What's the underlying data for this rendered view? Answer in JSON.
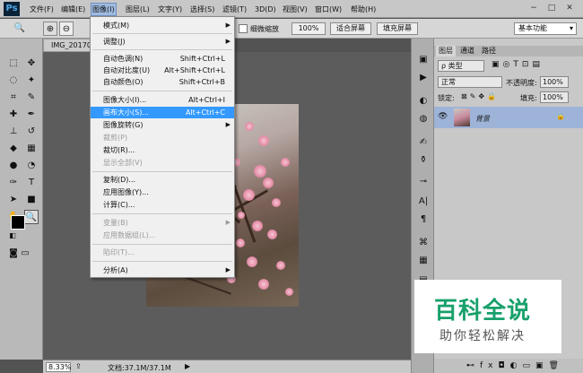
{
  "app": {
    "logo": "Ps"
  },
  "menubar": {
    "items": [
      "文件(F)",
      "编辑(E)",
      "图像(I)",
      "图层(L)",
      "文字(Y)",
      "选择(S)",
      "滤镜(T)",
      "3D(D)",
      "视图(V)",
      "窗口(W)",
      "帮助(H)"
    ],
    "active": "图像(I)"
  },
  "window_controls": {
    "minimize": "−",
    "maximize": "□",
    "close": "✕"
  },
  "options": {
    "fit_label": "细微缩放",
    "zoom_btn": "100%",
    "fit_screen": "适合屏幕",
    "fill_screen": "填充屏幕",
    "workspace": "基本功能"
  },
  "document": {
    "tab": "IMG_20170..."
  },
  "image_menu": {
    "mode": "模式(M)",
    "adjust": "调整(J)",
    "auto_tone": "自动色调(N)",
    "auto_tone_sc": "Shift+Ctrl+L",
    "auto_contrast": "自动对比度(U)",
    "auto_contrast_sc": "Alt+Shift+Ctrl+L",
    "auto_color": "自动颜色(O)",
    "auto_color_sc": "Shift+Ctrl+B",
    "image_size": "图像大小(I)...",
    "image_size_sc": "Alt+Ctrl+I",
    "canvas_size": "画布大小(S)...",
    "canvas_size_sc": "Alt+Ctrl+C",
    "rotate": "图像旋转(G)",
    "crop": "裁剪(P)",
    "trim": "裁切(R)...",
    "reveal_all": "显示全部(V)",
    "duplicate": "复制(D)...",
    "apply_image": "应用图像(Y)...",
    "calculations": "计算(C)...",
    "variables": "变量(B)",
    "apply_dataset": "应用数据组(L)...",
    "trap": "陷印(T)...",
    "analysis": "分析(A)"
  },
  "layers_panel": {
    "tabs": [
      "图层",
      "通道",
      "路径"
    ],
    "filter": "ρ 类型",
    "blend_mode": "正常",
    "opacity_label": "不透明度:",
    "opacity": "100%",
    "lock_label": "锁定:",
    "fill_label": "填充:",
    "fill": "100%",
    "layer_name": "背景"
  },
  "status": {
    "zoom": "8.33%",
    "doc_info": "文档:37.1M/37.1M"
  },
  "watermark": {
    "title": "百科全说",
    "subtitle": "助你轻松解决"
  }
}
